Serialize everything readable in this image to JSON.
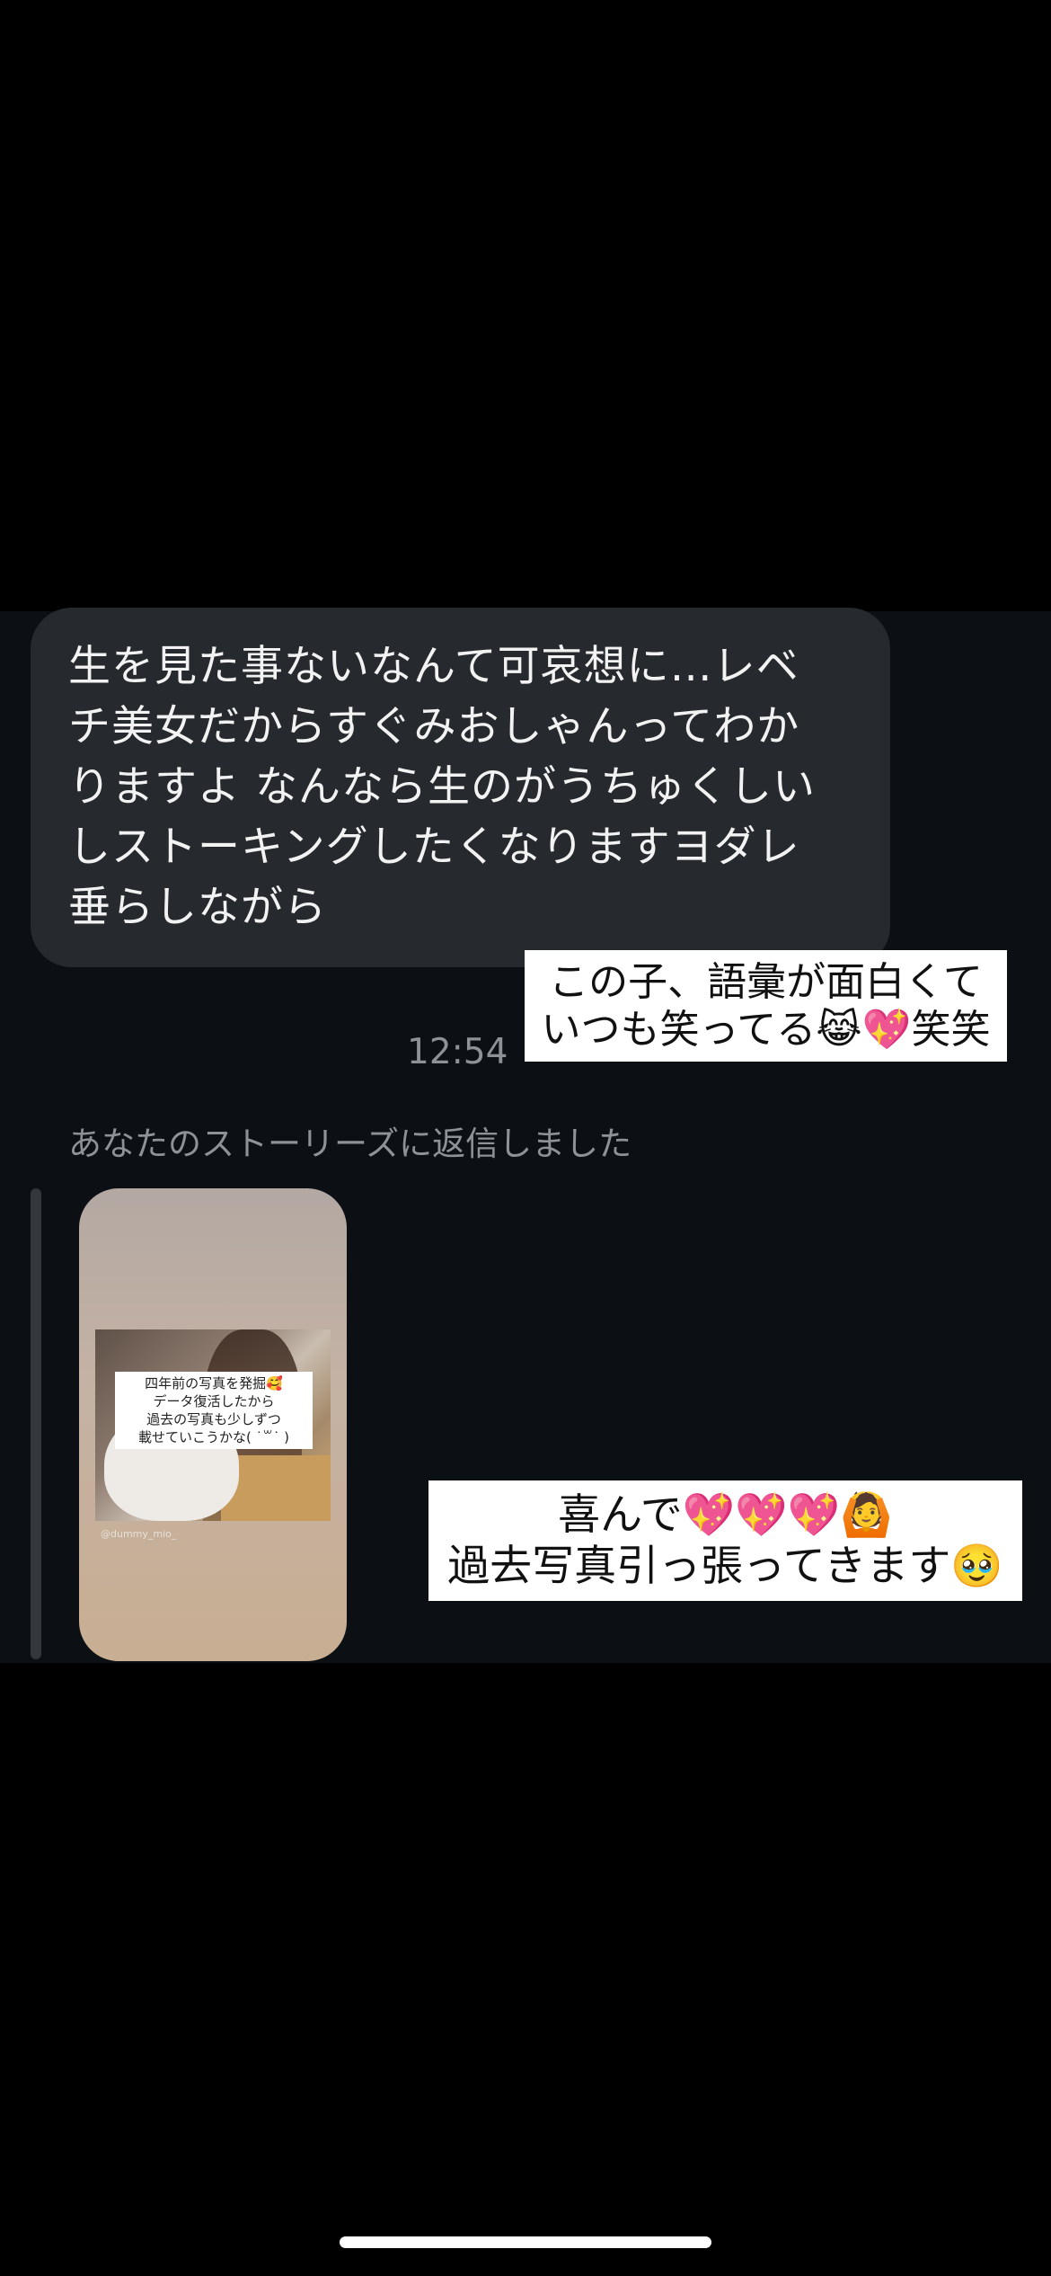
{
  "message": {
    "lines": [
      "生を見た事ないなんて可哀想に…レベ",
      "チ美女だからすぐみおしゃんってわか",
      "りますよ なんなら生のがうちゅくしい",
      "しストーキングしたくなりますヨダレ",
      "垂らしながら"
    ]
  },
  "caption_1": {
    "lines": [
      "この子、語彙が面白くて",
      "いつも笑ってる😹💖笑笑"
    ]
  },
  "timestamp": "12:54",
  "story_reply": {
    "label": "あなたのストーリーズに返信しました",
    "story_text_lines": [
      "四年前の写真を発掘🥰",
      "データ復活したから",
      "過去の写真も少しずつ",
      "載せていこうかな( ˙꒳˙ )"
    ],
    "story_handle": "@dummy_mio_"
  },
  "caption_2": {
    "lines": [
      "喜んで💖💖💖🙆",
      "過去写真引っ張ってきます🥹"
    ]
  },
  "colors": {
    "background": "#000000",
    "chat_background": "#0c1014",
    "bubble": "#262a2f",
    "secondary_text": "#8e9296",
    "caption_background": "#ffffff"
  }
}
